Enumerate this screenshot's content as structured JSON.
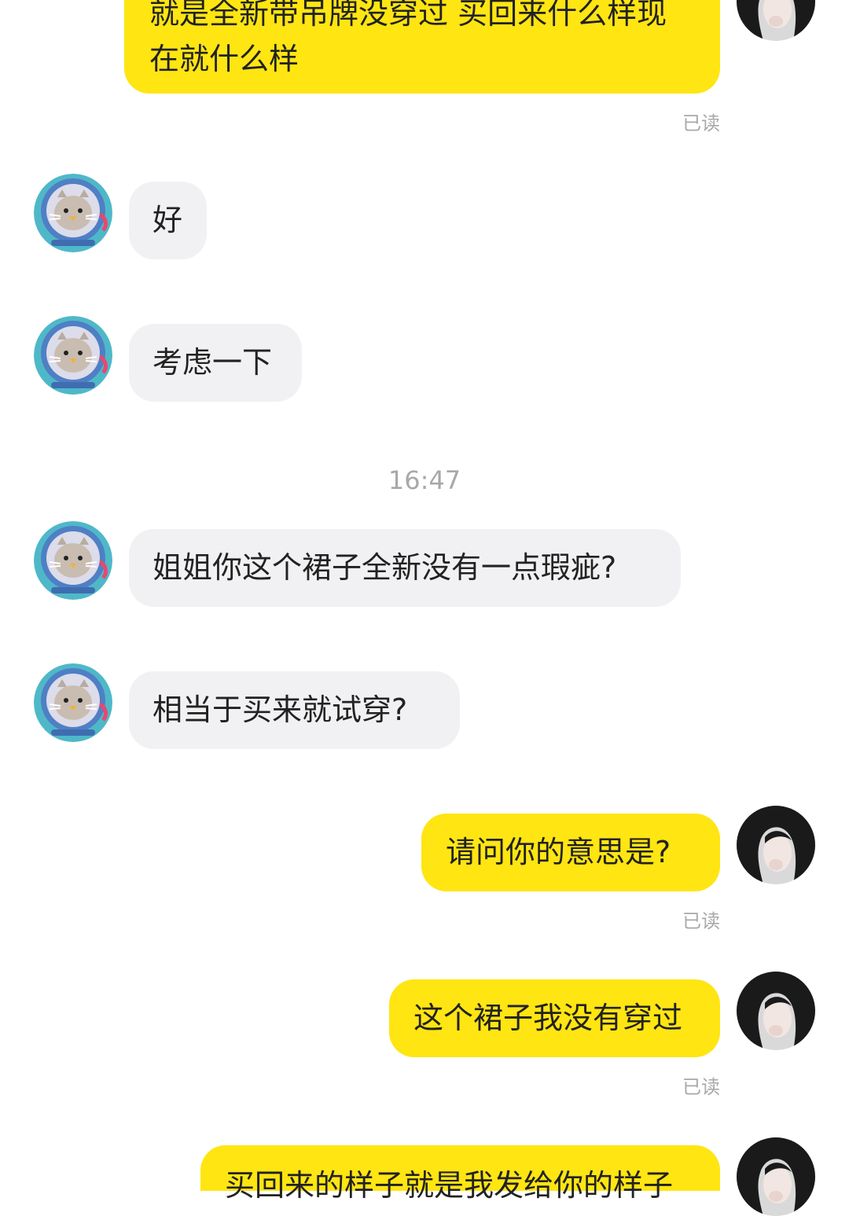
{
  "messages": {
    "m1_line1": "就是全新带吊牌没穿过 买回来什么样现",
    "m1_line2": "在就什么样",
    "m2": "好",
    "m3": "考虑一下",
    "time_divider": "16:47",
    "m4": "姐姐你这个裙子全新没有一点瑕疵?",
    "m5": "相当于买来就试穿?",
    "m6": "请问你的意思是?",
    "m7": "这个裙子我没有穿过",
    "m8": "买回来的样子就是我发给你的样子"
  },
  "status": {
    "read_label": "已读"
  },
  "colors": {
    "my_bubble": "#ffe512",
    "their_bubble": "#f1f1f3",
    "meta_text": "#a8a8a8"
  },
  "icons": {
    "their_avatar": "cat-astronaut-avatar-icon",
    "my_avatar": "girl-portrait-avatar-icon"
  }
}
